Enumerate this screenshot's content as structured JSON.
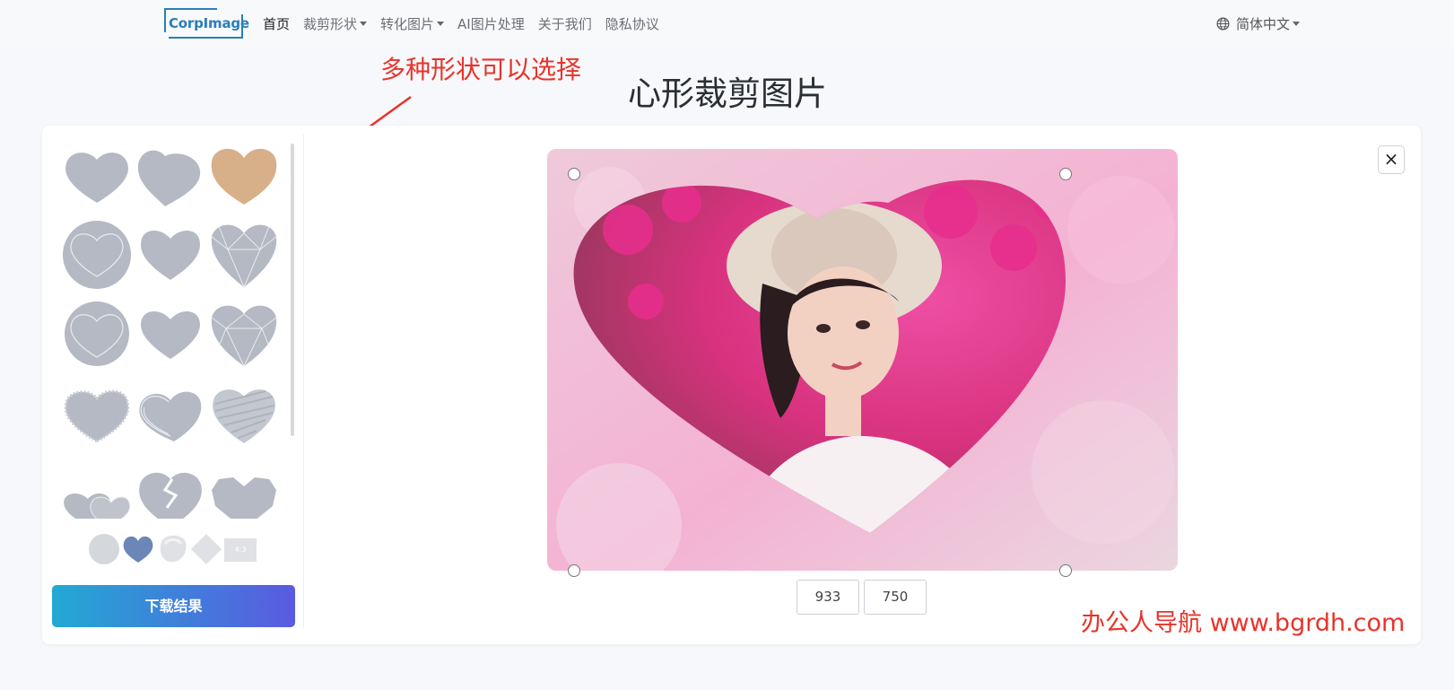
{
  "navbar": {
    "logo_text": "CorpImage",
    "items": [
      {
        "label": "首页",
        "active": true,
        "dropdown": false
      },
      {
        "label": "裁剪形状",
        "active": false,
        "dropdown": true
      },
      {
        "label": "转化图片",
        "active": false,
        "dropdown": true
      },
      {
        "label": "AI图片处理",
        "active": false,
        "dropdown": false
      },
      {
        "label": "关于我们",
        "active": false,
        "dropdown": false
      },
      {
        "label": "隐私协议",
        "active": false,
        "dropdown": false
      }
    ],
    "language": "简体中文",
    "language_icon": "globe-icon"
  },
  "annotation": {
    "text": "多种形状可以选择",
    "color": "#e8332a"
  },
  "page": {
    "title": "心形裁剪图片"
  },
  "shapes": {
    "selected_index": 2,
    "selected_color": "#d7b08a",
    "default_color": "#b4b9c3",
    "items": [
      "heart-shape",
      "heart-tilted-shape",
      "heart-shape",
      "circle-heart-outline-shape",
      "heart-rounded-shape",
      "heart-faceted-shape",
      "circle-heart-outline-shape",
      "heart-shape",
      "heart-faceted-shape",
      "heart-rough-shape",
      "heart-sketch-shape",
      "heart-scribble-shape",
      "double-heart-shape",
      "broken-heart-shape",
      "heart-polygon-shape"
    ],
    "quick_options": [
      "circle",
      "heart",
      "blob",
      "diamond",
      "4:3"
    ]
  },
  "actions": {
    "download_label": "下载结果",
    "close_label": "×"
  },
  "dimensions": {
    "width": "933",
    "height": "750"
  },
  "watermark": {
    "text": "办公人导航  www.bgrdh.com"
  }
}
